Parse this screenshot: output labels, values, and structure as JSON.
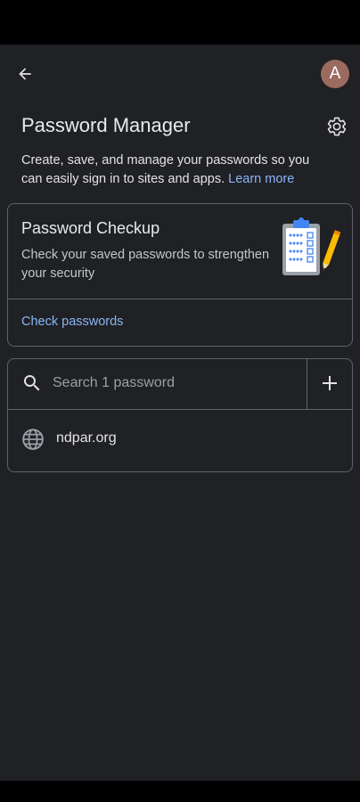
{
  "header": {
    "avatar_initial": "A",
    "title": "Password Manager"
  },
  "intro": {
    "description": "Create, save, and manage your passwords so you can easily sign in to sites and apps.",
    "learn_more": "Learn more"
  },
  "checkup": {
    "title": "Password Checkup",
    "description": "Check your saved passwords to strengthen your security",
    "action": "Check passwords"
  },
  "search": {
    "placeholder": "Search 1 password"
  },
  "passwords": [
    {
      "site": "ndpar.org",
      "icon": "globe-icon"
    }
  ],
  "icons": {
    "back": "arrow-left-icon",
    "settings": "gear-icon",
    "search": "search-icon",
    "add": "plus-icon"
  },
  "colors": {
    "background": "#202124",
    "accent_link": "#8ab4f8",
    "avatar": "#9a6b5e",
    "border": "#5f6368"
  }
}
